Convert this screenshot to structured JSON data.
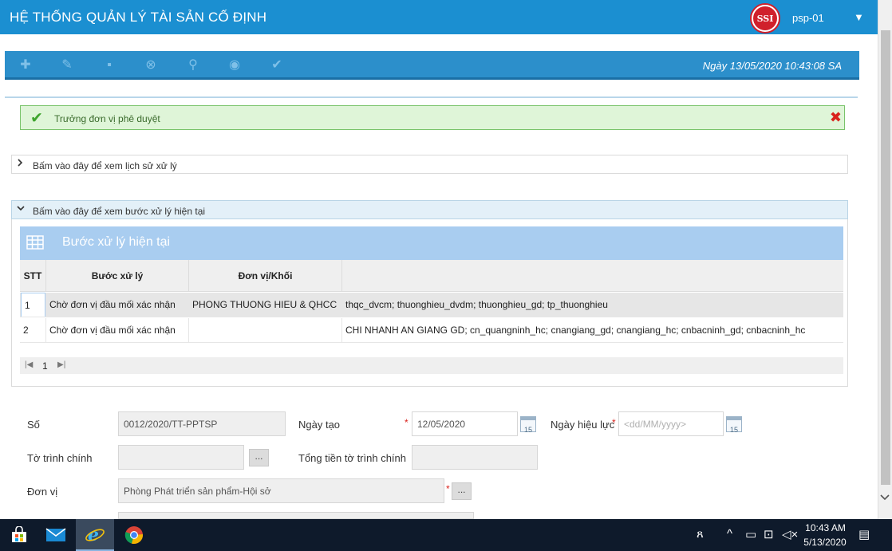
{
  "header": {
    "title": "HỆ THỐNG QUẢN LÝ TÀI SẢN CỐ ĐỊNH",
    "logo_text": "SSI",
    "user": "psp-01",
    "caret": "▼"
  },
  "toolbar": {
    "buttons": {
      "add": "✚",
      "edit": "✎",
      "save": "▪",
      "cancel": "⊗",
      "search": "⚲",
      "view": "◉",
      "approve": "✔"
    },
    "datetime": "Ngày 13/05/2020   10:43:08 SA"
  },
  "alert": {
    "text": "Trưởng đơn vị phê duyệt",
    "check": "✔",
    "close": "✖"
  },
  "panels": {
    "history": {
      "label": "Bấm vào đây để xem lịch sử xử lý",
      "arrow": "›"
    },
    "current": {
      "label": "Bấm vào đây để xem bước xử lý hiện tại",
      "arrow": "⌄"
    }
  },
  "grid": {
    "title": "Bước xử lý hiện tại",
    "columns": [
      "STT",
      "Bước xử lý",
      "Đơn vị/Khối",
      ""
    ],
    "rows": [
      {
        "stt": "1",
        "step": "Chờ đơn vị đầu mối xác nhận",
        "unit": "PHONG THUONG HIEU & QHCC",
        "users": "thqc_dvcm; thuonghieu_dvdm; thuonghieu_gd; tp_thuonghieu"
      },
      {
        "stt": "2",
        "step": "Chờ đơn vị đầu mối xác nhận",
        "unit": "",
        "users": "CHI NHANH AN GIANG GD; cn_quangninh_hc; cnangiang_gd; cnangiang_hc; cnbacninh_gd; cnbacninh_hc"
      }
    ],
    "pager": {
      "first": "|◀",
      "page": "1",
      "next": "▶|"
    }
  },
  "form": {
    "so": {
      "label": "Số",
      "value": "0012/2020/TT-PPTSP"
    },
    "ngay_tao": {
      "label": "Ngày tạo",
      "value": "12/05/2020",
      "cal": "15"
    },
    "ngay_hieu_luc": {
      "label": "Ngày hiệu lực",
      "placeholder": "<dd/MM/yyyy>",
      "cal": "15"
    },
    "to_trinh_chinh": {
      "label": "Tờ trình chính",
      "value": "",
      "btn": "..."
    },
    "tong_tien": {
      "label": "Tổng tiền tờ trình chính",
      "value": ""
    },
    "don_vi": {
      "label": "Đơn vị",
      "value": "Phòng Phát triển sản phẩm-Hội sở",
      "btn": "..."
    },
    "required_mark": "*"
  },
  "taskbar": {
    "time": "10:43 AM",
    "date": "5/13/2020",
    "sys_person": "ጸ",
    "sys_up": "^",
    "sys_battery": "▭",
    "sys_network": "⊡",
    "sys_volume": "◁×",
    "sys_notify": "▤"
  },
  "colors": {
    "header_bg": "#1b8fd1",
    "toolbar_bg": "#2c8fcb",
    "alert_bg": "#dff5d8",
    "grid_title_bg": "#a9cdf0",
    "required": "#d9221c"
  }
}
